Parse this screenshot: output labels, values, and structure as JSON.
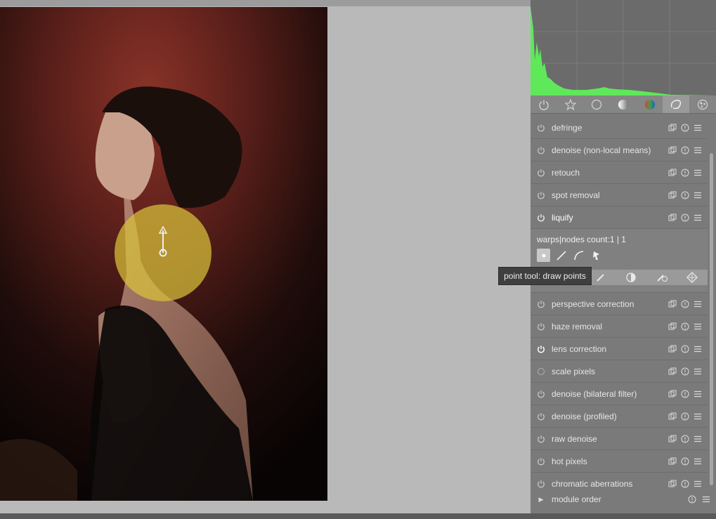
{
  "tabs": [
    {
      "icon": "power-icon",
      "active": false
    },
    {
      "icon": "star-icon",
      "active": false
    },
    {
      "icon": "circle-icon",
      "active": false
    },
    {
      "icon": "tone-icon",
      "active": false
    },
    {
      "icon": "color-icon",
      "active": false
    },
    {
      "icon": "correct-icon",
      "active": true
    },
    {
      "icon": "effect-icon",
      "active": false
    }
  ],
  "modules_top": [
    {
      "label": "defringe"
    },
    {
      "label": "denoise (non-local means)"
    },
    {
      "label": "retouch"
    },
    {
      "label": "spot removal"
    },
    {
      "label": "liquify"
    }
  ],
  "liquify": {
    "warps_label": "warps|nodes count:1 | 1",
    "tools": [
      "point-tool-icon",
      "line-tool-icon",
      "curve-tool-icon",
      "node-tool-icon"
    ]
  },
  "tooltip": "point tool: draw points",
  "modules_bottom": [
    {
      "label": "perspective correction"
    },
    {
      "label": "haze removal"
    },
    {
      "label": "lens correction"
    },
    {
      "label": "scale pixels"
    },
    {
      "label": "denoise (bilateral filter)"
    },
    {
      "label": "denoise (profiled)"
    },
    {
      "label": "raw denoise"
    },
    {
      "label": "hot pixels"
    },
    {
      "label": "chromatic aberrations"
    }
  ],
  "module_order_label": "module order",
  "colors": {
    "histogram_green": "#5ee85a",
    "panel_bg": "#7a7a7a",
    "warp_yellow": "#d8c23a"
  }
}
